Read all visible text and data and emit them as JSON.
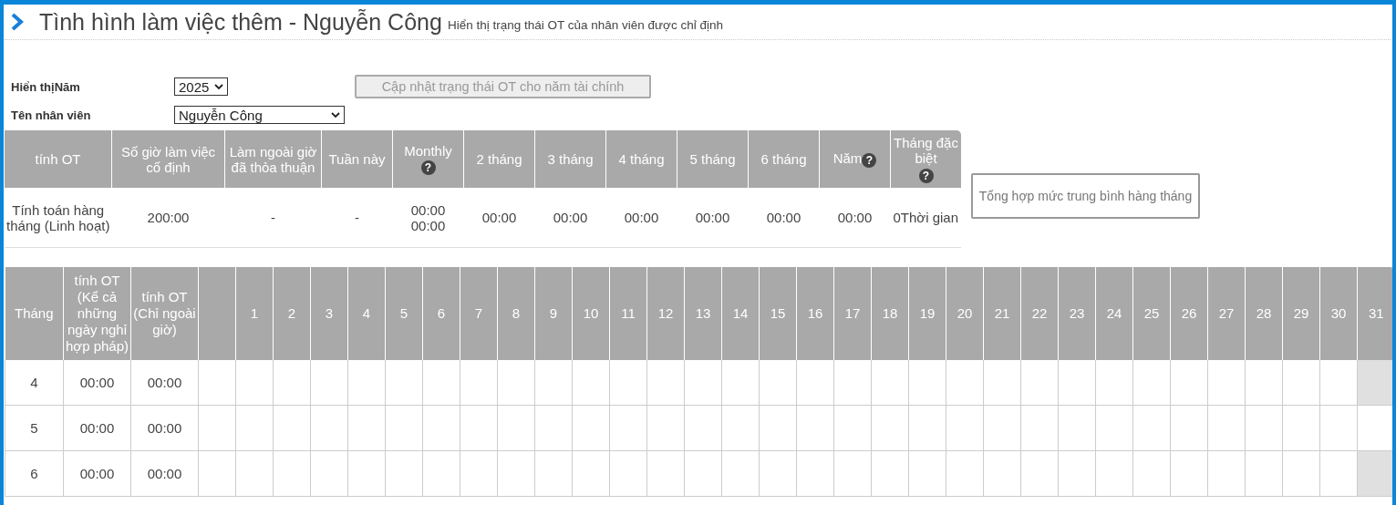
{
  "header": {
    "title": "Tình hình làm việc thêm - Nguyễn Công",
    "subtitle": "Hiển thị trạng thái OT của nhân viên được chỉ định"
  },
  "form": {
    "year_label": "Hiển thịNăm",
    "year_value": "2025",
    "employee_label": "Tên nhân viên",
    "employee_value": "Nguyễn Công",
    "update_button": {
      "label": "Cập nhật trạng thái OT cho năm tài chính",
      "disabled": true
    }
  },
  "summary_table": {
    "columns": [
      {
        "label": "tính OT"
      },
      {
        "label": "Số giờ làm việc cố định"
      },
      {
        "label": "Làm ngoài giờ đã thỏa thuận"
      },
      {
        "label": "Tuần này"
      },
      {
        "label": "Monthly",
        "help_icon": "?",
        "icon_below": true
      },
      {
        "label": "2 tháng"
      },
      {
        "label": "3 tháng"
      },
      {
        "label": "4 tháng"
      },
      {
        "label": "5 tháng"
      },
      {
        "label": "6 tháng"
      },
      {
        "label": "Năm",
        "help_icon": "?",
        "icon_below": false
      },
      {
        "label": "Tháng đặc biệt",
        "help_icon": "?",
        "icon_below": true
      }
    ],
    "row": [
      "Tính toán hàng tháng (Linh hoạt)",
      "200:00",
      "-",
      "-",
      "00:00\n00:00",
      "00:00",
      "00:00",
      "00:00",
      "00:00",
      "00:00",
      "00:00",
      "0Thời gian"
    ]
  },
  "summary_button": "Tổng hợp mức trung bình hàng tháng",
  "daily_table": {
    "columns": [
      "Tháng",
      "tính OT (Kể cả những ngày nghỉ hợp pháp)",
      "tính OT (Chỉ ngoài giờ)",
      "",
      "1",
      "2",
      "3",
      "4",
      "5",
      "6",
      "7",
      "8",
      "9",
      "10",
      "11",
      "12",
      "13",
      "14",
      "15",
      "16",
      "17",
      "18",
      "19",
      "20",
      "21",
      "22",
      "23",
      "24",
      "25",
      "26",
      "27",
      "28",
      "29",
      "30",
      "31"
    ],
    "rows": [
      {
        "month": "4",
        "ot_including_holidays": "00:00",
        "ot_overtime_only": "00:00",
        "day_31_disabled": true
      },
      {
        "month": "5",
        "ot_including_holidays": "00:00",
        "ot_overtime_only": "00:00",
        "day_31_disabled": false
      },
      {
        "month": "6",
        "ot_including_holidays": "00:00",
        "ot_overtime_only": "00:00",
        "day_31_disabled": true
      }
    ]
  }
}
